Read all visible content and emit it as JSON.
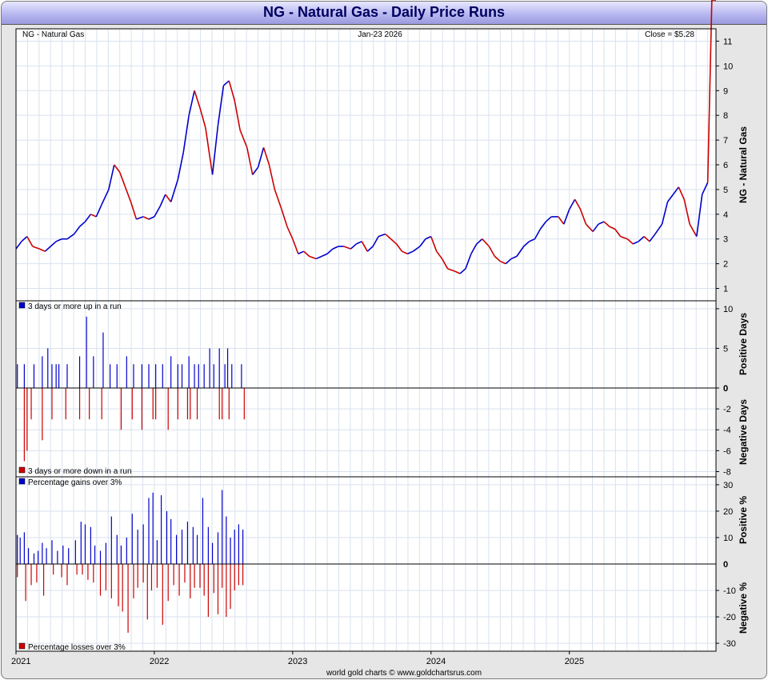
{
  "window": {
    "title": "NG  -  Natural Gas - Daily Price Runs"
  },
  "header": {
    "symbol": "NG  -  Natural Gas",
    "date": "Jan-23  2026",
    "close": "Close = $5.28"
  },
  "footer": {
    "credit": "world gold charts © www.goldchartsrus.com"
  },
  "colors": {
    "up": "#0000cc",
    "down": "#cc0000",
    "grid": "#d9e2ee",
    "title_bg": "#b8b8f0",
    "title_text": "#000060"
  },
  "chart_data": [
    {
      "type": "line",
      "title": "NG  -  Natural Gas",
      "ylabel": "NG  -  Natural Gas",
      "ylim": [
        0.5,
        11.5
      ],
      "yticks": [
        1,
        2,
        3,
        4,
        5,
        6,
        7,
        8,
        9,
        10,
        11
      ],
      "xlim": [
        2021.0,
        2026.06
      ],
      "xticks": [
        2021,
        2022,
        2023,
        2024,
        2025
      ],
      "xtick_labels": [
        "2021",
        "2022",
        "2023",
        "2024",
        "2025"
      ],
      "x": [
        2021.0,
        2021.04,
        2021.08,
        2021.12,
        2021.17,
        2021.21,
        2021.25,
        2021.29,
        2021.33,
        2021.37,
        2021.42,
        2021.46,
        2021.5,
        2021.54,
        2021.58,
        2021.62,
        2021.67,
        2021.71,
        2021.75,
        2021.79,
        2021.83,
        2021.87,
        2021.92,
        2021.96,
        2022.0,
        2022.04,
        2022.08,
        2022.12,
        2022.17,
        2022.21,
        2022.25,
        2022.29,
        2022.33,
        2022.37,
        2022.42,
        2022.46,
        2022.5,
        2022.54,
        2022.58,
        2022.62,
        2022.67,
        2022.71,
        2022.75,
        2022.79,
        2022.83,
        2022.87,
        2022.92,
        2022.96,
        2023.0,
        2023.04,
        2023.08,
        2023.12,
        2023.17,
        2023.21,
        2023.25,
        2023.29,
        2023.33,
        2023.37,
        2023.42,
        2023.46,
        2023.5,
        2023.54,
        2023.58,
        2023.62,
        2023.67,
        2023.71,
        2023.75,
        2023.79,
        2023.83,
        2023.87,
        2023.92,
        2023.96,
        2024.0,
        2024.04,
        2024.08,
        2024.12,
        2024.17,
        2024.21,
        2024.25,
        2024.29,
        2024.33,
        2024.37,
        2024.42,
        2024.46,
        2024.5,
        2024.54,
        2024.58,
        2024.62,
        2024.67,
        2024.71,
        2024.75,
        2024.79,
        2024.83,
        2024.87,
        2024.92,
        2024.96,
        2025.0,
        2025.04,
        2025.08,
        2025.12,
        2025.17,
        2025.21,
        2025.25,
        2025.29,
        2025.33,
        2025.37,
        2025.42,
        2025.46,
        2025.5,
        2025.54,
        2025.58,
        2025.62,
        2025.67,
        2025.71,
        2025.75,
        2025.79,
        2025.83,
        2025.87,
        2025.92,
        2025.96,
        2026.0,
        2026.03,
        2026.06
      ],
      "values": [
        2.6,
        2.9,
        3.1,
        2.7,
        2.6,
        2.5,
        2.7,
        2.9,
        3.0,
        3.0,
        3.2,
        3.5,
        3.7,
        4.0,
        3.9,
        4.4,
        5.0,
        6.0,
        5.7,
        5.1,
        4.5,
        3.8,
        3.9,
        3.8,
        3.9,
        4.3,
        4.8,
        4.5,
        5.4,
        6.5,
        8.0,
        9.0,
        8.3,
        7.5,
        5.6,
        7.6,
        9.2,
        9.4,
        8.6,
        7.4,
        6.7,
        5.6,
        5.9,
        6.7,
        6.0,
        5.0,
        4.2,
        3.5,
        3.0,
        2.4,
        2.5,
        2.3,
        2.2,
        2.3,
        2.4,
        2.6,
        2.7,
        2.7,
        2.6,
        2.8,
        2.9,
        2.5,
        2.7,
        3.1,
        3.2,
        3.0,
        2.8,
        2.5,
        2.4,
        2.5,
        2.7,
        3.0,
        3.1,
        2.5,
        2.2,
        1.8,
        1.7,
        1.6,
        1.8,
        2.4,
        2.8,
        3.0,
        2.7,
        2.3,
        2.1,
        2.0,
        2.2,
        2.3,
        2.7,
        2.9,
        3.0,
        3.4,
        3.7,
        3.9,
        3.9,
        3.6,
        4.2,
        4.6,
        4.2,
        3.6,
        3.3,
        3.6,
        3.7,
        3.5,
        3.4,
        3.1,
        3.0,
        2.8,
        2.9,
        3.1,
        2.9,
        3.2,
        3.6,
        4.5,
        4.8,
        5.1,
        4.6,
        3.6,
        3.1,
        4.8,
        5.28
      ]
    },
    {
      "type": "bar",
      "title": "3 days or more up in a run",
      "ylabel": "Positive Days",
      "ylim": [
        0,
        11
      ],
      "yticks": [
        0,
        5,
        10
      ],
      "series": [
        {
          "name": "3 days or more up in a run",
          "x": [
            2021.01,
            2021.06,
            2021.13,
            2021.19,
            2021.23,
            2021.26,
            2021.29,
            2021.31,
            2021.37,
            2021.46,
            2021.51,
            2021.56,
            2021.63,
            2021.68,
            2021.73,
            2021.8,
            2021.85,
            2021.91,
            2021.96,
            2022.01,
            2022.06,
            2022.12,
            2022.17,
            2022.2,
            2022.25,
            2022.29,
            2022.32,
            2022.36,
            2022.4,
            2022.43,
            2022.47,
            2022.51,
            2022.53,
            2022.56,
            2022.63
          ],
          "values": [
            3,
            3,
            3,
            4,
            5,
            3,
            3,
            3,
            3,
            4,
            9,
            4,
            7,
            3,
            3,
            4,
            3,
            3,
            3,
            3,
            3,
            4,
            3,
            3,
            4,
            3,
            3,
            3,
            5,
            3,
            5,
            3,
            5,
            3,
            3
          ]
        }
      ]
    },
    {
      "type": "bar",
      "title": "3 days or more down in a run",
      "ylabel": "Negative Days",
      "ylim": [
        -8.5,
        0
      ],
      "yticks": [
        -2,
        -4,
        -6,
        -8
      ],
      "series": [
        {
          "name": "3 days or more down in a run",
          "x": [
            2021.06,
            2021.08,
            2021.11,
            2021.19,
            2021.26,
            2021.36,
            2021.46,
            2021.53,
            2021.62,
            2021.76,
            2021.84,
            2021.91,
            2021.99,
            2022.01,
            2022.1,
            2022.17,
            2022.24,
            2022.26,
            2022.31,
            2022.47,
            2022.49,
            2022.54,
            2022.65
          ],
          "values": [
            -7,
            -6,
            -3,
            -5,
            -3,
            -3,
            -3,
            -3,
            -3,
            -4,
            -3,
            -4,
            -3,
            -3,
            -4,
            -3,
            -3,
            -3,
            -3,
            -3,
            -3,
            -3,
            -3
          ]
        }
      ]
    },
    {
      "type": "bar",
      "title": "Percentage gains over 3%",
      "ylabel": "Positive %",
      "ylim": [
        0,
        33
      ],
      "yticks": [
        10,
        20,
        30
      ],
      "series": [
        {
          "name": "Percentage gains over 3%",
          "x": [
            2021.01,
            2021.03,
            2021.06,
            2021.09,
            2021.13,
            2021.16,
            2021.19,
            2021.22,
            2021.26,
            2021.3,
            2021.34,
            2021.38,
            2021.43,
            2021.47,
            2021.5,
            2021.54,
            2021.57,
            2021.61,
            2021.65,
            2021.69,
            2021.73,
            2021.76,
            2021.8,
            2021.84,
            2021.88,
            2021.92,
            2021.96,
            2021.99,
            2022.02,
            2022.05,
            2022.09,
            2022.12,
            2022.16,
            2022.2,
            2022.24,
            2022.28,
            2022.31,
            2022.35,
            2022.39,
            2022.42,
            2022.46,
            2022.49,
            2022.52,
            2022.55,
            2022.58,
            2022.61,
            2022.64
          ],
          "values": [
            11,
            10,
            12,
            6,
            4,
            5,
            8,
            6,
            9,
            5,
            7,
            6,
            9,
            16,
            15,
            14,
            7,
            5,
            8,
            18,
            11,
            7,
            10,
            19,
            13,
            15,
            25,
            27,
            9,
            26,
            20,
            17,
            11,
            13,
            16,
            14,
            11,
            25,
            14,
            8,
            12,
            28,
            18,
            10,
            13,
            15,
            13
          ]
        }
      ]
    },
    {
      "type": "bar",
      "title": "Percentage losses over 3%",
      "ylabel": "Negative %",
      "ylim": [
        -33,
        0
      ],
      "yticks": [
        -10,
        -20,
        -30
      ],
      "series": [
        {
          "name": "Percentage losses over 3%",
          "x": [
            2021.01,
            2021.07,
            2021.11,
            2021.15,
            2021.2,
            2021.27,
            2021.33,
            2021.37,
            2021.44,
            2021.48,
            2021.52,
            2021.56,
            2021.61,
            2021.65,
            2021.69,
            2021.74,
            2021.77,
            2021.81,
            2021.85,
            2021.88,
            2021.92,
            2021.95,
            2021.98,
            2022.02,
            2022.06,
            2022.1,
            2022.14,
            2022.18,
            2022.22,
            2022.26,
            2022.29,
            2022.33,
            2022.36,
            2022.39,
            2022.43,
            2022.46,
            2022.49,
            2022.52,
            2022.55,
            2022.58,
            2022.61,
            2022.64
          ],
          "values": [
            -5,
            -14,
            -8,
            -7,
            -12,
            -4,
            -5,
            -8,
            -4,
            -4,
            -6,
            -7,
            -12,
            -10,
            -13,
            -16,
            -18,
            -26,
            -13,
            -9,
            -7,
            -21,
            -10,
            -9,
            -23,
            -14,
            -8,
            -12,
            -7,
            -13,
            -9,
            -9,
            -12,
            -20,
            -11,
            -19,
            -9,
            -20,
            -17,
            -10,
            -8,
            -8
          ]
        }
      ]
    }
  ]
}
